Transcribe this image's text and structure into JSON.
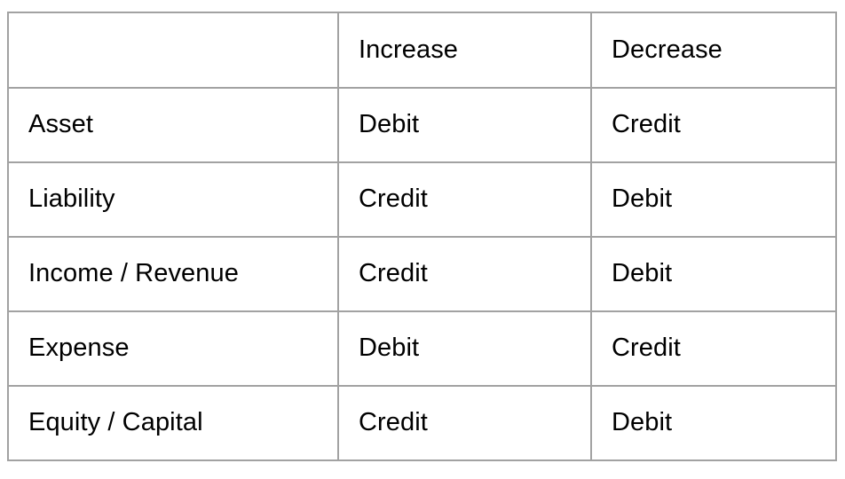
{
  "table": {
    "name": "debit-credit-rules-table",
    "columns": [
      {
        "key": "account_type",
        "label": ""
      },
      {
        "key": "increase",
        "label": "Increase"
      },
      {
        "key": "decrease",
        "label": "Decrease"
      }
    ],
    "rows": [
      {
        "account_type": "Asset",
        "increase": "Debit",
        "decrease": "Credit"
      },
      {
        "account_type": "Liability",
        "increase": "Credit",
        "decrease": "Debit"
      },
      {
        "account_type": "Income / Revenue",
        "increase": "Credit",
        "decrease": "Debit"
      },
      {
        "account_type": "Expense",
        "increase": "Debit",
        "decrease": "Credit"
      },
      {
        "account_type": "Equity / Capital",
        "increase": "Credit",
        "decrease": "Debit"
      }
    ]
  },
  "style": {
    "border_color": "#a2a2a2",
    "text_color": "#000000",
    "background_color": "#ffffff"
  }
}
